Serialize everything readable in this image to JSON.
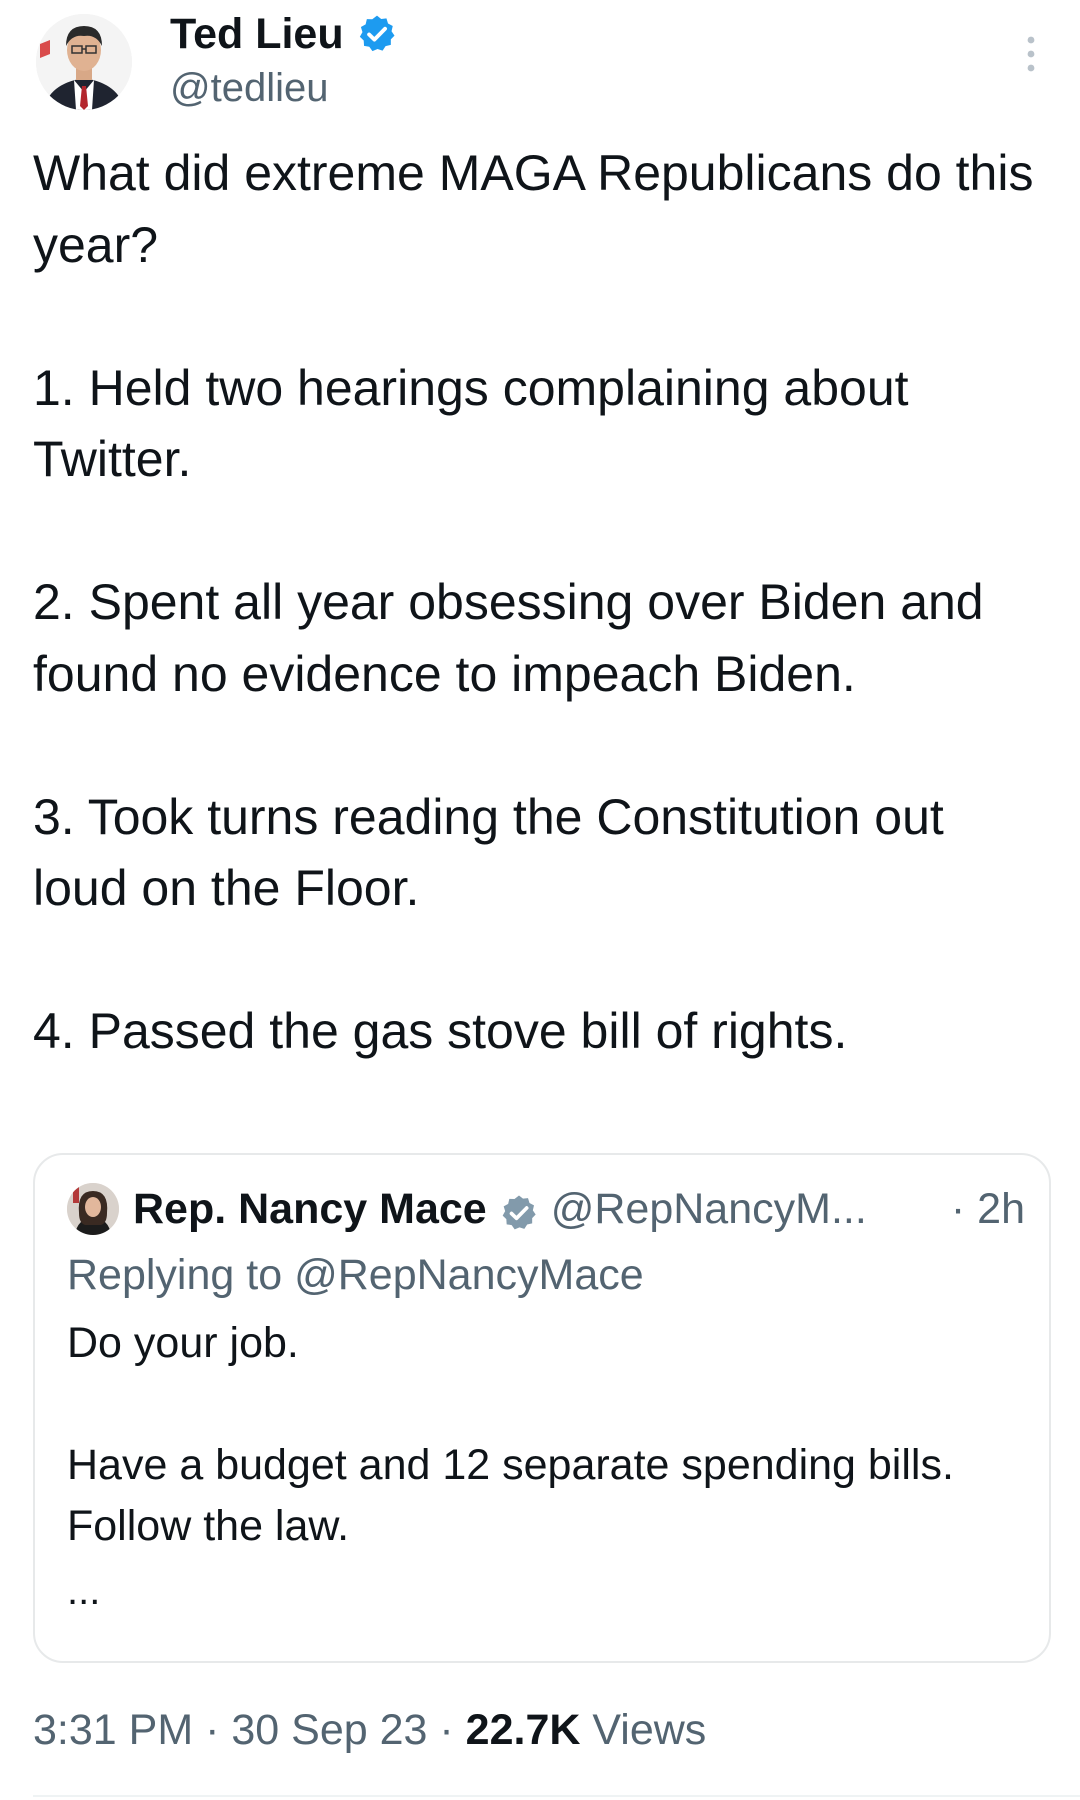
{
  "tweet": {
    "author": {
      "display_name": "Ted Lieu",
      "handle": "@tedlieu",
      "verified": true,
      "avatar_icon": "profile-photo-man-suit"
    },
    "text": "What did extreme MAGA Republicans do this year?\n\n1. Held two hearings complaining about Twitter.\n\n2. Spent all year obsessing over Biden and found no evidence to impeach Biden.\n\n3. Took turns reading the Constitution out loud on the Floor.\n\n4. Passed the gas stove bill of rights.",
    "quoted": {
      "display_name": "Rep. Nancy Mace",
      "handle": "@RepNancyM...",
      "time": "· 2h",
      "verified_badge": "gray",
      "replying_to_prefix": "Replying to ",
      "replying_to_handle": "@RepNancyMace",
      "text": "Do your job.\n\nHave a budget and 12 separate spending bills. Follow the law.",
      "truncation": "..."
    },
    "meta": {
      "time": "3:31 PM",
      "separator": "·",
      "date": "30 Sep 23",
      "views_count": "22.7K",
      "views_label": "Views"
    }
  },
  "colors": {
    "text": "#0f1419",
    "secondary": "#536471",
    "verified_blue": "#1d9bf0",
    "verified_gray": "#829aab",
    "border": "#e7e9ea"
  }
}
